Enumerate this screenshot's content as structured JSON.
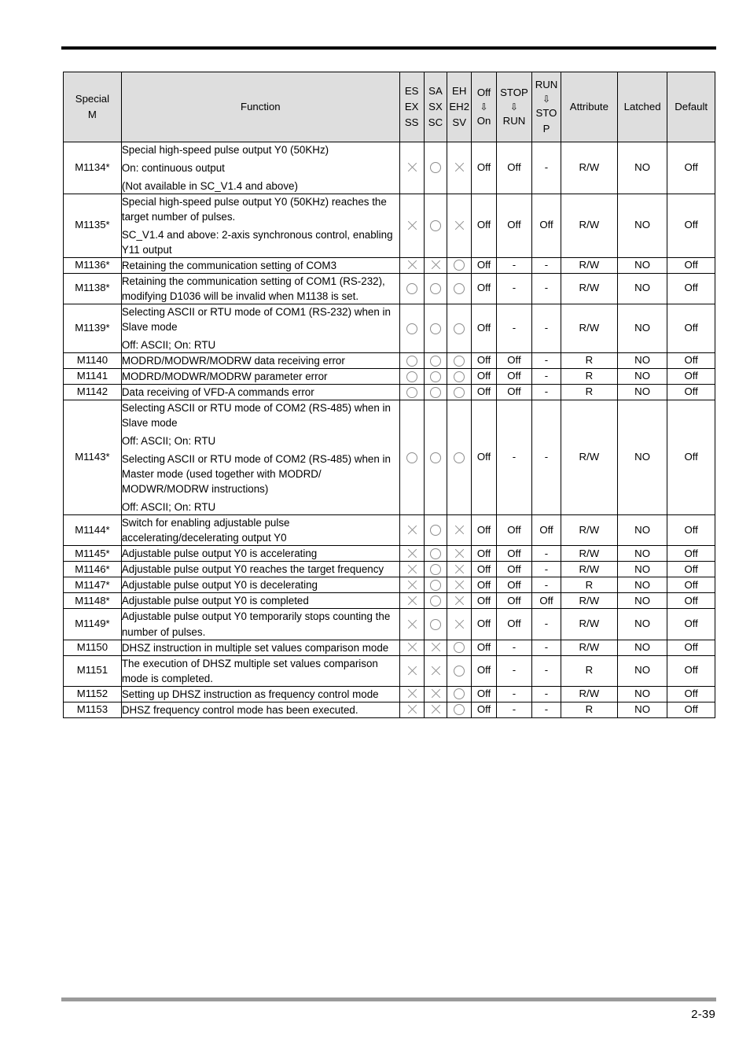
{
  "page": {
    "number": "2-39"
  },
  "table": {
    "headers": {
      "special_m": [
        "Special",
        "M"
      ],
      "function": "Function",
      "es_group": [
        "ES",
        "EX",
        "SS"
      ],
      "sa_group": [
        "SA",
        "SX",
        "SC"
      ],
      "eh_group": [
        "EH",
        "EH2",
        "SV"
      ],
      "off_on": [
        "Off",
        "⇩",
        "On"
      ],
      "stop_run": [
        "STOP",
        "⇩",
        "RUN"
      ],
      "run_stop": [
        "RUN",
        "⇩",
        "STO",
        "P"
      ],
      "attribute": "Attribute",
      "latched": "Latched",
      "default": "Default"
    },
    "rows": [
      {
        "name": "M1134*",
        "function": [
          "Special high-speed pulse output Y0 (50KHz)",
          "On: continuous output",
          "(Not available in SC_V1.4 and above)"
        ],
        "es": "cross",
        "sa": "circle",
        "eh": "cross",
        "off_on": "Off",
        "stop_run": "Off",
        "run_stop": "-",
        "attribute": "R/W",
        "latched": "NO",
        "default": "Off"
      },
      {
        "name": "M1135*",
        "function": [
          "Special high-speed pulse output Y0 (50KHz) reaches the target number of pulses.",
          "SC_V1.4 and above: 2-axis synchronous control, enabling Y11 output"
        ],
        "es": "cross",
        "sa": "circle",
        "eh": "cross",
        "off_on": "Off",
        "stop_run": "Off",
        "run_stop": "Off",
        "attribute": "R/W",
        "latched": "NO",
        "default": "Off"
      },
      {
        "name": "M1136*",
        "function": [
          "Retaining the communication setting of COM3"
        ],
        "es": "cross",
        "sa": "cross",
        "eh": "circle",
        "off_on": "Off",
        "stop_run": "-",
        "run_stop": "-",
        "attribute": "R/W",
        "latched": "NO",
        "default": "Off"
      },
      {
        "name": "M1138*",
        "function": [
          "Retaining the communication setting of COM1 (RS-232), modifying D1036 will be invalid when M1138 is set."
        ],
        "es": "circle",
        "sa": "circle",
        "eh": "circle",
        "off_on": "Off",
        "stop_run": "-",
        "run_stop": "-",
        "attribute": "R/W",
        "latched": "NO",
        "default": "Off"
      },
      {
        "name": "M1139*",
        "function": [
          "Selecting ASCII or RTU mode of COM1 (RS-232) when in Slave mode",
          "Off: ASCII; On: RTU"
        ],
        "es": "circle",
        "sa": "circle",
        "eh": "circle",
        "off_on": "Off",
        "stop_run": "-",
        "run_stop": "-",
        "attribute": "R/W",
        "latched": "NO",
        "default": "Off"
      },
      {
        "name": "M1140",
        "function": [
          "MODRD/MODWR/MODRW data receiving error"
        ],
        "es": "circle",
        "sa": "circle",
        "eh": "circle",
        "off_on": "Off",
        "stop_run": "Off",
        "run_stop": "-",
        "attribute": "R",
        "latched": "NO",
        "default": "Off"
      },
      {
        "name": "M1141",
        "function": [
          "MODRD/MODWR/MODRW parameter error"
        ],
        "es": "circle",
        "sa": "circle",
        "eh": "circle",
        "off_on": "Off",
        "stop_run": "Off",
        "run_stop": "-",
        "attribute": "R",
        "latched": "NO",
        "default": "Off"
      },
      {
        "name": "M1142",
        "function": [
          "Data receiving of VFD-A commands error"
        ],
        "es": "circle",
        "sa": "circle",
        "eh": "circle",
        "off_on": "Off",
        "stop_run": "Off",
        "run_stop": "-",
        "attribute": "R",
        "latched": "NO",
        "default": "Off"
      },
      {
        "name": "M1143*",
        "function": [
          "Selecting ASCII or RTU mode of COM2 (RS-485) when in Slave mode",
          "Off: ASCII; On: RTU",
          "Selecting ASCII or RTU mode of COM2 (RS-485) when in Master mode (used together with MODRD/ MODWR/MODRW instructions)",
          "Off: ASCII; On: RTU"
        ],
        "es": "circle",
        "sa": "circle",
        "eh": "circle",
        "off_on": "Off",
        "stop_run": "-",
        "run_stop": "-",
        "attribute": "R/W",
        "latched": "NO",
        "default": "Off"
      },
      {
        "name": "M1144*",
        "function": [
          "Switch for enabling adjustable pulse accelerating/decelerating output Y0"
        ],
        "es": "cross",
        "sa": "circle",
        "eh": "cross",
        "off_on": "Off",
        "stop_run": "Off",
        "run_stop": "Off",
        "attribute": "R/W",
        "latched": "NO",
        "default": "Off"
      },
      {
        "name": "M1145*",
        "function": [
          "Adjustable pulse output Y0 is accelerating"
        ],
        "es": "cross",
        "sa": "circle",
        "eh": "cross",
        "off_on": "Off",
        "stop_run": "Off",
        "run_stop": "-",
        "attribute": "R/W",
        "latched": "NO",
        "default": "Off"
      },
      {
        "name": "M1146*",
        "function": [
          "Adjustable pulse output Y0 reaches the target frequency"
        ],
        "es": "cross",
        "sa": "circle",
        "eh": "cross",
        "off_on": "Off",
        "stop_run": "Off",
        "run_stop": "-",
        "attribute": "R/W",
        "latched": "NO",
        "default": "Off"
      },
      {
        "name": "M1147*",
        "function": [
          "Adjustable pulse output Y0 is decelerating"
        ],
        "es": "cross",
        "sa": "circle",
        "eh": "cross",
        "off_on": "Off",
        "stop_run": "Off",
        "run_stop": "-",
        "attribute": "R",
        "latched": "NO",
        "default": "Off"
      },
      {
        "name": "M1148*",
        "function": [
          "Adjustable pulse output Y0 is completed"
        ],
        "es": "cross",
        "sa": "circle",
        "eh": "cross",
        "off_on": "Off",
        "stop_run": "Off",
        "run_stop": "Off",
        "attribute": "R/W",
        "latched": "NO",
        "default": "Off"
      },
      {
        "name": "M1149*",
        "function": [
          "Adjustable pulse output Y0 temporarily stops counting the number of pulses."
        ],
        "es": "cross",
        "sa": "circle",
        "eh": "cross",
        "off_on": "Off",
        "stop_run": "Off",
        "run_stop": "-",
        "attribute": "R/W",
        "latched": "NO",
        "default": "Off"
      },
      {
        "name": "M1150",
        "function": [
          "DHSZ instruction in multiple set values comparison mode"
        ],
        "es": "cross",
        "sa": "cross",
        "eh": "circle",
        "off_on": "Off",
        "stop_run": "-",
        "run_stop": "-",
        "attribute": "R/W",
        "latched": "NO",
        "default": "Off"
      },
      {
        "name": "M1151",
        "function": [
          "The execution of DHSZ multiple set values comparison mode is completed."
        ],
        "es": "cross",
        "sa": "cross",
        "eh": "circle",
        "off_on": "Off",
        "stop_run": "-",
        "run_stop": "-",
        "attribute": "R",
        "latched": "NO",
        "default": "Off"
      },
      {
        "name": "M1152",
        "function": [
          "Setting up DHSZ instruction as frequency control mode"
        ],
        "es": "cross",
        "sa": "cross",
        "eh": "circle",
        "off_on": "Off",
        "stop_run": "-",
        "run_stop": "-",
        "attribute": "R/W",
        "latched": "NO",
        "default": "Off"
      },
      {
        "name": "M1153",
        "function": [
          "DHSZ frequency control mode has been executed."
        ],
        "es": "cross",
        "sa": "cross",
        "eh": "circle",
        "off_on": "Off",
        "stop_run": "-",
        "run_stop": "-",
        "attribute": "R",
        "latched": "NO",
        "default": "Off"
      }
    ]
  }
}
